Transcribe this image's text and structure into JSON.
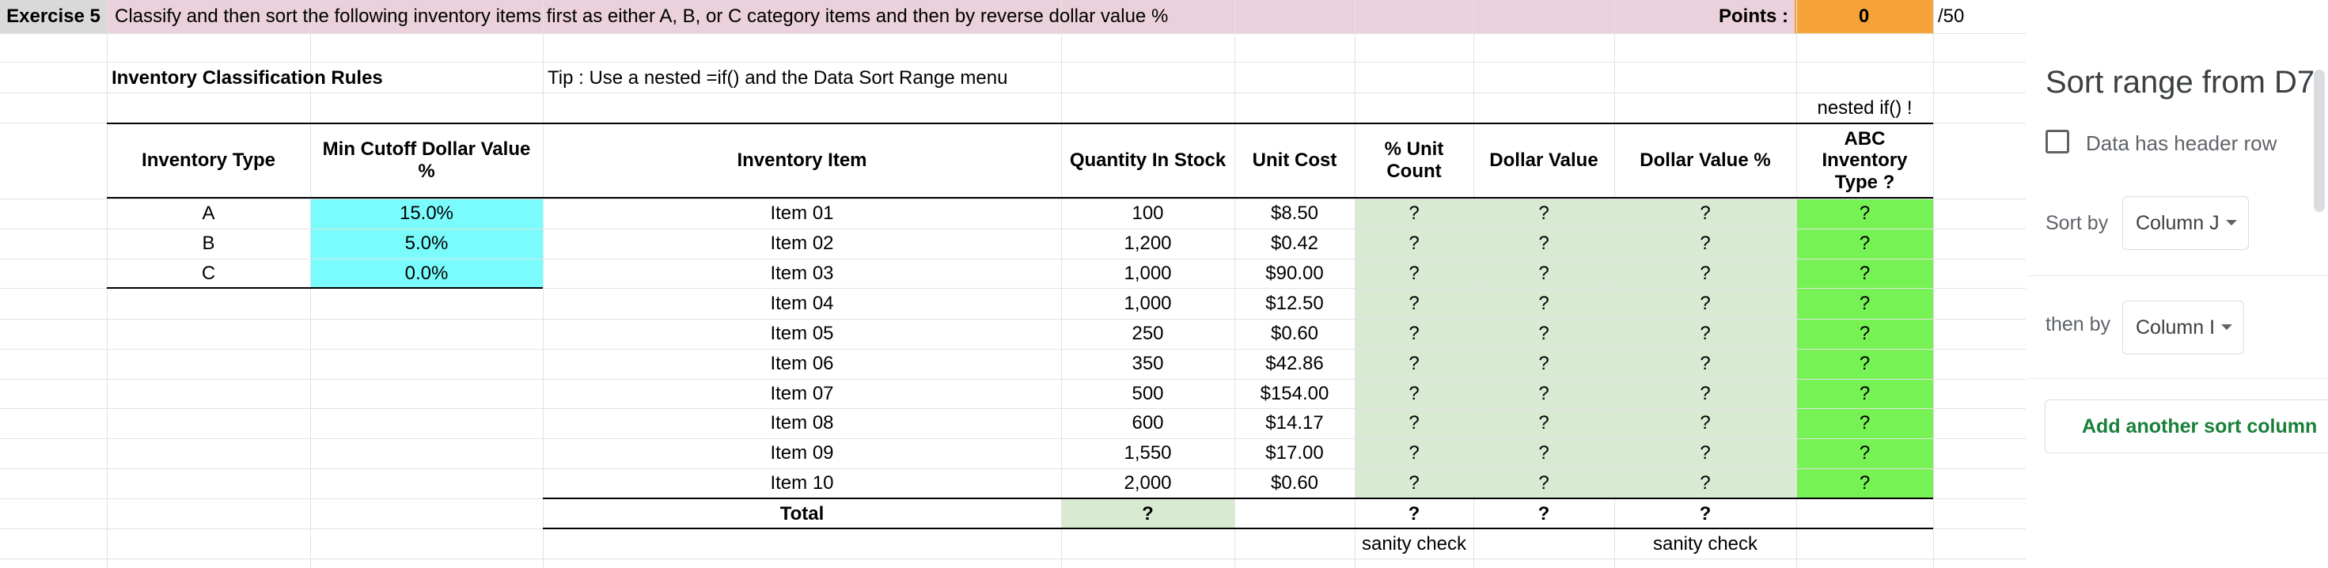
{
  "header": {
    "exercise_label": "Exercise 5",
    "instructions": "Classify and then sort the following inventory items first as either A, B, or C category items and then by reverse dollar value %",
    "points_label": "Points :",
    "points_value": "0",
    "points_max": "/50"
  },
  "rules": {
    "title": "Inventory Classification Rules",
    "col_type": "Inventory Type",
    "col_cutoff": "Min Cutoff Dollar Value %",
    "rows": [
      {
        "type": "A",
        "cutoff": "15.0%"
      },
      {
        "type": "B",
        "cutoff": "5.0%"
      },
      {
        "type": "C",
        "cutoff": "0.0%"
      }
    ]
  },
  "tip": "Tip : Use a nested =if() and the Data Sort Range menu",
  "nested_note": "nested if() !",
  "table": {
    "headers": {
      "item": "Inventory Item",
      "qty": "Quantity In Stock",
      "cost": "Unit Cost",
      "pct_count": "% Unit Count",
      "dollar": "Dollar Value",
      "dollar_pct": "Dollar Value %",
      "abc": "ABC Inventory Type ?"
    },
    "rows": [
      {
        "item": "Item 01",
        "qty": "100",
        "cost": "$8.50",
        "pct_count": "?",
        "dollar": "?",
        "dollar_pct": "?",
        "abc": "?"
      },
      {
        "item": "Item 02",
        "qty": "1,200",
        "cost": "$0.42",
        "pct_count": "?",
        "dollar": "?",
        "dollar_pct": "?",
        "abc": "?"
      },
      {
        "item": "Item 03",
        "qty": "1,000",
        "cost": "$90.00",
        "pct_count": "?",
        "dollar": "?",
        "dollar_pct": "?",
        "abc": "?"
      },
      {
        "item": "Item 04",
        "qty": "1,000",
        "cost": "$12.50",
        "pct_count": "?",
        "dollar": "?",
        "dollar_pct": "?",
        "abc": "?"
      },
      {
        "item": "Item 05",
        "qty": "250",
        "cost": "$0.60",
        "pct_count": "?",
        "dollar": "?",
        "dollar_pct": "?",
        "abc": "?"
      },
      {
        "item": "Item 06",
        "qty": "350",
        "cost": "$42.86",
        "pct_count": "?",
        "dollar": "?",
        "dollar_pct": "?",
        "abc": "?"
      },
      {
        "item": "Item 07",
        "qty": "500",
        "cost": "$154.00",
        "pct_count": "?",
        "dollar": "?",
        "dollar_pct": "?",
        "abc": "?"
      },
      {
        "item": "Item 08",
        "qty": "600",
        "cost": "$14.17",
        "pct_count": "?",
        "dollar": "?",
        "dollar_pct": "?",
        "abc": "?"
      },
      {
        "item": "Item 09",
        "qty": "1,550",
        "cost": "$17.00",
        "pct_count": "?",
        "dollar": "?",
        "dollar_pct": "?",
        "abc": "?"
      },
      {
        "item": "Item 10",
        "qty": "2,000",
        "cost": "$0.60",
        "pct_count": "?",
        "dollar": "?",
        "dollar_pct": "?",
        "abc": "?"
      }
    ],
    "total": {
      "label": "Total",
      "qty": "?",
      "pct_count": "?",
      "dollar": "?",
      "dollar_pct": "?"
    },
    "sanity_check_1": "sanity check",
    "sanity_check_2": "sanity check"
  },
  "sort_panel": {
    "title": "Sort range from D7",
    "header_row_label": "Data has header row",
    "header_row_checked": false,
    "sort_by_label": "Sort by",
    "sort_by_value": "Column J",
    "then_by_label": "then by",
    "then_by_value": "Column I",
    "add_column_label": "Add another sort column"
  },
  "colors": {
    "header_band": "#ead1dc",
    "points_orange": "#f6a43a",
    "cutoff_cyan": "#7afcfd",
    "light_green": "#d9ead3",
    "bright_green": "#77f254",
    "panel_green_text": "#188038"
  }
}
